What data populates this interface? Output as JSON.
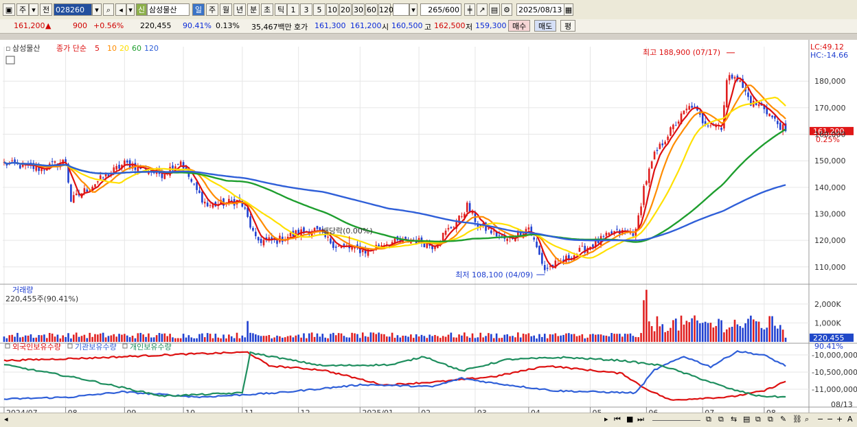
{
  "toolbar": {
    "mode_ju": "주",
    "mode_jeon": "전",
    "stock_code": "028260",
    "badge_new": "신",
    "stock_name": "삼성물산",
    "periods": [
      "일",
      "주",
      "월",
      "년",
      "분",
      "초",
      "틱"
    ],
    "active_period": "일",
    "intervals": [
      "1",
      "3",
      "5",
      "10",
      "20",
      "30",
      "60",
      "120"
    ],
    "count_display": "265",
    "count_max": "/600",
    "date": "2025/08/13"
  },
  "quote": {
    "price": "161,200",
    "arrow": "▲",
    "change": "900",
    "change_pct": "+0.56%",
    "volume": "220,455",
    "volume_ratio": "90.41%",
    "turnover_pct": "0.13%",
    "amount": "35,467백만",
    "bid_label": "호가",
    "bid": "161,300",
    "ask": "161,200",
    "open_label": "시",
    "open": "160,500",
    "high_label": "고",
    "high": "162,500",
    "low_label": "저",
    "low": "159,300",
    "buy_label": "매수",
    "sell_label": "매도",
    "eval_label": "평"
  },
  "chart_data": {
    "type": "candlestick",
    "price_pane": {
      "stock_label": "삼성물산",
      "legend": {
        "title": "종가 단순",
        "periods": [
          "5",
          "10",
          "20",
          "60",
          "120"
        ],
        "colors": [
          "#dd1010",
          "#ff8c00",
          "#ffe000",
          "#1e9e2e",
          "#2f5fd8"
        ]
      },
      "ylim": [
        104000,
        193000
      ],
      "y_ticks": [
        110000,
        120000,
        130000,
        140000,
        150000,
        160000,
        170000,
        180000
      ],
      "y_tick_labels": [
        "110,000",
        "120,000",
        "130,000",
        "140,000",
        "150,000",
        "160,000",
        "170,000",
        "180,000"
      ],
      "lc_label": "LC:49.12",
      "hc_label": "HC:-14.66",
      "current_price_label": "161,200",
      "current_change_label": "0.25%",
      "current_price": 161200,
      "annotations": {
        "high": {
          "text": "최고 188,900 (07/17)",
          "date": "2025-07-17",
          "price": 188900
        },
        "low": {
          "text": "최저 108,100 (04/09)",
          "date": "2025-04-09",
          "price": 108100
        },
        "dividend": {
          "text": "배당락(0.00%)",
          "date": "2024-12-27",
          "price": 118000
        }
      },
      "close_anchors": [
        [
          "2024-07-01",
          149000
        ],
        [
          "2024-07-20",
          147000
        ],
        [
          "2024-08-01",
          150000
        ],
        [
          "2024-08-05",
          135000
        ],
        [
          "2024-08-20",
          143000
        ],
        [
          "2024-09-02",
          149000
        ],
        [
          "2024-09-20",
          145000
        ],
        [
          "2024-10-01",
          150000
        ],
        [
          "2024-10-08",
          140000
        ],
        [
          "2024-10-15",
          133000
        ],
        [
          "2024-10-31",
          135000
        ],
        [
          "2024-11-04",
          131000
        ],
        [
          "2024-11-08",
          120000
        ],
        [
          "2024-11-20",
          120000
        ],
        [
          "2024-12-02",
          123000
        ],
        [
          "2024-12-10",
          124000
        ],
        [
          "2024-12-20",
          118000
        ],
        [
          "2025-01-06",
          116000
        ],
        [
          "2025-01-15",
          119000
        ],
        [
          "2025-01-31",
          120000
        ],
        [
          "2025-02-10",
          118000
        ],
        [
          "2025-02-24",
          128000
        ],
        [
          "2025-02-27",
          133000
        ],
        [
          "2025-03-05",
          126000
        ],
        [
          "2025-03-20",
          120000
        ],
        [
          "2025-04-01",
          125000
        ],
        [
          "2025-04-09",
          109000
        ],
        [
          "2025-04-21",
          113000
        ],
        [
          "2025-05-02",
          118000
        ],
        [
          "2025-05-15",
          123000
        ],
        [
          "2025-05-27",
          123000
        ],
        [
          "2025-05-30",
          140000
        ],
        [
          "2025-06-05",
          152000
        ],
        [
          "2025-06-12",
          160000
        ],
        [
          "2025-06-20",
          168000
        ],
        [
          "2025-06-25",
          171000
        ],
        [
          "2025-07-01",
          165000
        ],
        [
          "2025-07-10",
          163000
        ],
        [
          "2025-07-14",
          180000
        ],
        [
          "2025-07-17",
          183000
        ],
        [
          "2025-07-25",
          172000
        ],
        [
          "2025-08-01",
          170000
        ],
        [
          "2025-08-07",
          165000
        ],
        [
          "2025-08-13",
          161200
        ]
      ]
    },
    "volume_pane": {
      "title": "거래량",
      "subtitle": "220,455주(90.41%)",
      "ylim": [
        0,
        2900000
      ],
      "y_ticks": [
        1000000,
        2000000
      ],
      "y_tick_labels": [
        "1,000K",
        "2,000K"
      ],
      "current_label": "220,455",
      "current_pct_label": "90.41%",
      "colors": {
        "up": "#e02020",
        "down": "#2040d0"
      }
    },
    "holdings_pane": {
      "legend": [
        "외국인보유수량",
        "기관보유수량",
        "개인보유수량"
      ],
      "legend_colors": [
        "#dd1010",
        "#2f5fd8",
        "#1e8e5e"
      ],
      "ylim": [
        -11500000,
        -9700000
      ],
      "y_ticks": [
        -10000000,
        -10500000,
        -11000000
      ],
      "y_tick_labels": [
        "-10,000,000",
        "-10,500,000",
        "-11,000,000"
      ],
      "series": [
        {
          "name": "외국인보유수량",
          "color": "#dd1010",
          "anchors": [
            [
              "2024-07-01",
              0.8
            ],
            [
              "2024-08-15",
              0.85
            ],
            [
              "2024-10-01",
              0.92
            ],
            [
              "2024-11-05",
              0.96
            ],
            [
              "2024-11-15",
              0.7
            ],
            [
              "2024-12-15",
              0.62
            ],
            [
              "2025-01-15",
              0.33
            ],
            [
              "2025-02-15",
              0.4
            ],
            [
              "2025-03-15",
              0.5
            ],
            [
              "2025-04-10",
              0.7
            ],
            [
              "2025-05-20",
              0.55
            ],
            [
              "2025-06-01",
              0.28
            ],
            [
              "2025-06-15",
              0.04
            ],
            [
              "2025-07-01",
              0.08
            ],
            [
              "2025-07-15",
              0.1
            ],
            [
              "2025-08-01",
              0.22
            ],
            [
              "2025-08-13",
              0.4
            ]
          ]
        },
        {
          "name": "기관보유수량",
          "color": "#2f5fd8",
          "anchors": [
            [
              "2024-07-01",
              0.06
            ],
            [
              "2024-08-05",
              0.1
            ],
            [
              "2024-09-01",
              0.2
            ],
            [
              "2024-10-10",
              0.1
            ],
            [
              "2024-11-20",
              0.18
            ],
            [
              "2025-01-05",
              0.34
            ],
            [
              "2025-02-10",
              0.3
            ],
            [
              "2025-02-25",
              0.46
            ],
            [
              "2025-03-15",
              0.36
            ],
            [
              "2025-04-15",
              0.22
            ],
            [
              "2025-05-27",
              0.18
            ],
            [
              "2025-06-05",
              0.62
            ],
            [
              "2025-06-20",
              0.88
            ],
            [
              "2025-07-05",
              0.68
            ],
            [
              "2025-07-20",
              0.98
            ],
            [
              "2025-08-01",
              0.9
            ],
            [
              "2025-08-13",
              0.7
            ]
          ]
        },
        {
          "name": "개인보유수량",
          "color": "#1e8e5e",
          "anchors": [
            [
              "2024-07-01",
              0.72
            ],
            [
              "2024-08-10",
              0.45
            ],
            [
              "2024-09-20",
              0.12
            ],
            [
              "2024-11-03",
              0.18
            ],
            [
              "2024-11-06",
              0.95
            ],
            [
              "2024-12-15",
              0.7
            ],
            [
              "2025-01-20",
              0.72
            ],
            [
              "2025-02-05",
              0.88
            ],
            [
              "2025-02-25",
              0.6
            ],
            [
              "2025-03-20",
              0.82
            ],
            [
              "2025-04-20",
              0.86
            ],
            [
              "2025-05-20",
              0.8
            ],
            [
              "2025-06-10",
              0.7
            ],
            [
              "2025-07-01",
              0.44
            ],
            [
              "2025-07-15",
              0.26
            ],
            [
              "2025-07-30",
              0.12
            ],
            [
              "2025-08-13",
              0.1
            ]
          ]
        }
      ]
    },
    "x_axis": {
      "start": "2024-07-01",
      "end": "2025-08-13",
      "tick_labels": [
        {
          "text": "2024/07",
          "date": "2024-07-01"
        },
        {
          "text": "08",
          "date": "2024-08-01"
        },
        {
          "text": "09",
          "date": "2024-09-02"
        },
        {
          "text": "10",
          "date": "2024-10-02"
        },
        {
          "text": "11",
          "date": "2024-11-01"
        },
        {
          "text": "12",
          "date": "2024-12-02"
        },
        {
          "text": "2025/01",
          "date": "2025-01-02"
        },
        {
          "text": "02",
          "date": "2025-02-03"
        },
        {
          "text": "03",
          "date": "2025-03-04"
        },
        {
          "text": "04",
          "date": "2025-04-01"
        },
        {
          "text": "05",
          "date": "2025-05-02"
        },
        {
          "text": "06",
          "date": "2025-06-02"
        },
        {
          "text": "07",
          "date": "2025-07-01"
        },
        {
          "text": "08",
          "date": "2025-08-01"
        }
      ],
      "end_label": "08/13"
    },
    "grid": true
  }
}
